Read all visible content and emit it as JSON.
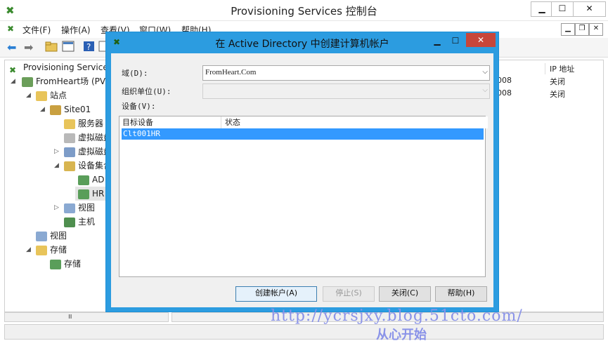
{
  "window": {
    "title": "Provisioning Services 控制台",
    "min": "▁",
    "max": "☐",
    "close": "✕"
  },
  "menu": [
    {
      "label": "文件(F)"
    },
    {
      "label": "操作(A)"
    },
    {
      "label": "查看(V)"
    },
    {
      "label": "窗口(W)"
    },
    {
      "label": "帮助(H)"
    }
  ],
  "tree": {
    "root": "Provisioning Service",
    "farm": "FromHeart场 (PV",
    "sites": "站点",
    "site01": "Site01",
    "servers": "服务器",
    "vdisk1": "虚拟磁盘",
    "vdisk2": "虚拟磁盘",
    "collections": "设备集合",
    "ad": "AD",
    "hr": "HR",
    "views1": "视图",
    "hosts": "主机",
    "views2": "视图",
    "storage": "存储",
    "storage_item": "存储"
  },
  "right_pane": {
    "col_ip": "IP 地址",
    "rows": [
      {
        "partial": "008",
        "ip": "关闭"
      },
      {
        "partial": "008",
        "ip": "关闭"
      }
    ]
  },
  "dialog": {
    "title": "在 Active Directory 中创建计算机帐户",
    "domain_label": "域(D):",
    "domain_value": "FromHeart.Com",
    "ou_label": "组织单位(U):",
    "ou_value": "",
    "devices_label": "设备(V):",
    "columns": [
      "目标设备",
      "状态"
    ],
    "rows": [
      {
        "device": "Clt001HR",
        "status": ""
      }
    ],
    "buttons": {
      "create": "创建帐户(A)",
      "stop": "停止(S)",
      "close": "关闭(C)",
      "help": "帮助(H)"
    }
  },
  "watermark": {
    "url": "http://ycrsjxy.blog.51cto.com/",
    "text": "从心开始"
  },
  "colors": {
    "dialog_frame": "#2c9ce0",
    "selection": "#3399ff",
    "close_button": "#c7463a"
  }
}
